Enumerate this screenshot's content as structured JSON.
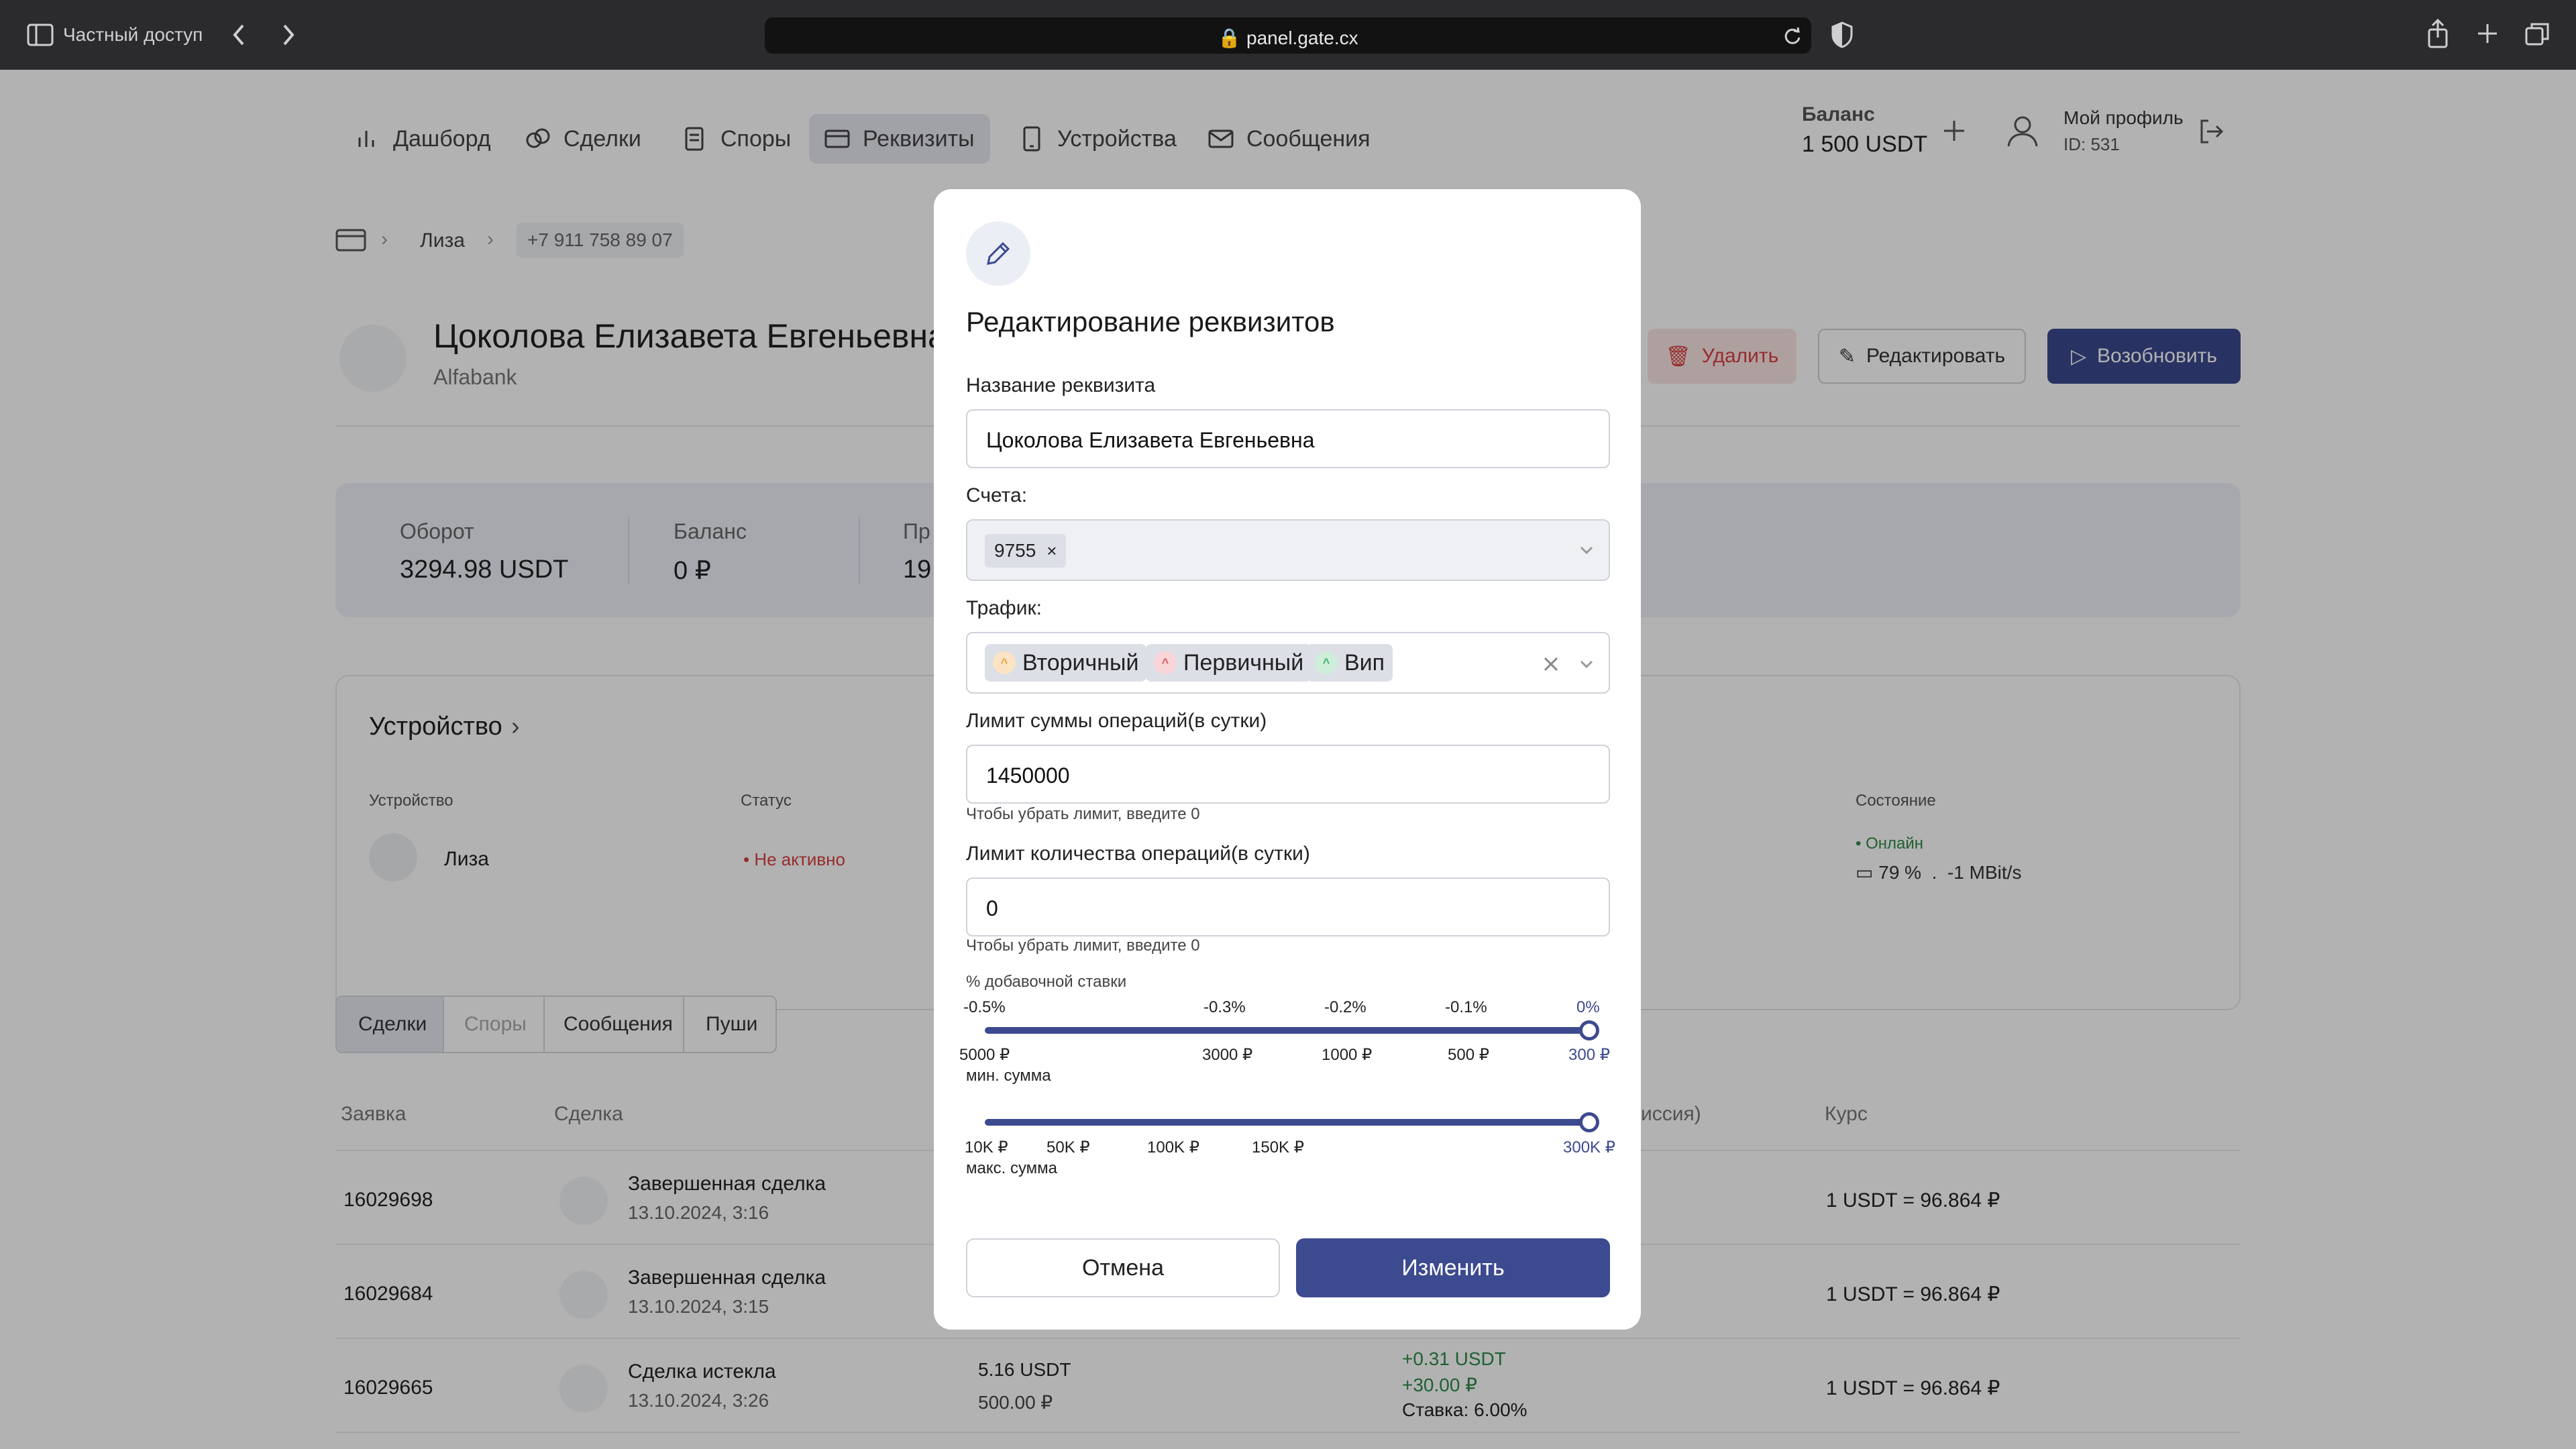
{
  "browser": {
    "private_label": "Частный доступ",
    "url": "panel.gate.cx"
  },
  "nav": {
    "items": [
      {
        "label": "Дашборд",
        "icon": "chart-icon"
      },
      {
        "label": "Сделки",
        "icon": "deals-icon"
      },
      {
        "label": "Споры",
        "icon": "disputes-icon"
      },
      {
        "label": "Реквизиты",
        "icon": "card-icon"
      },
      {
        "label": "Устройства",
        "icon": "device-icon"
      },
      {
        "label": "Сообщения",
        "icon": "mail-icon"
      }
    ],
    "balance_label": "Баланс",
    "balance_value": "1 500 USDT",
    "profile_label": "Мой профиль",
    "profile_id": "ID: 531"
  },
  "breadcrumb": {
    "item1": "Лиза",
    "item2": "+7 911 758 89 07"
  },
  "requisite": {
    "name": "Цоколова Елизавета Евгеньевна",
    "bank": "Alfabank",
    "delete_label": "Удалить",
    "edit_label": "Редактировать",
    "resume_label": "Возобновить"
  },
  "stats": {
    "turnover_label": "Оборот",
    "turnover_value": "3294.98 USDT",
    "balance_label": "Баланс",
    "balance_value": "0 ₽",
    "partial_label": "Пр",
    "partial_value": "19"
  },
  "device_card": {
    "title": "Устройство",
    "col_device": "Устройство",
    "col_status": "Статус",
    "col_state": "Состояние",
    "device_name": "Лиза",
    "status": "Не активно",
    "state": "Онлайн",
    "battery": "79 %",
    "separator": ".",
    "speed": "-1 MBit/s"
  },
  "tabs": [
    "Сделки",
    "Споры",
    "Сообщения",
    "Пуши"
  ],
  "table": {
    "col_request": "Заявка",
    "col_deal": "Сделка",
    "col_commission_tail": "иссия)",
    "col_rate": "Курс",
    "rows": [
      {
        "id": "16029698",
        "title": "Завершенная сделка",
        "date": "13.10.2024, 3:16",
        "rate": "1 USDT = 96.864 ₽"
      },
      {
        "id": "16029684",
        "title": "Завершенная сделка",
        "date": "13.10.2024, 3:15",
        "rate": "1 USDT = 96.864 ₽"
      },
      {
        "id": "16029665",
        "title": "Сделка истекла",
        "date": "13.10.2024, 3:26",
        "amount_usdt": "5.16 USDT",
        "amount_rub": "500.00 ₽",
        "comm_usdt": "+0.31 USDT",
        "comm_rub": "+30.00 ₽",
        "comm_rate": "Ставка: 6.00%",
        "rate": "1 USDT = 96.864 ₽"
      }
    ]
  },
  "modal": {
    "title": "Редактирование реквизитов",
    "name_label": "Название реквизита",
    "name_value": "Цоколова Елизавета Евгеньевна",
    "accounts_label": "Счета:",
    "account_chip": "9755",
    "traffic_label": "Трафик:",
    "traffic_chips": [
      {
        "label": "Вторичный",
        "color": "#f0a23a"
      },
      {
        "label": "Первичный",
        "color": "#e0525a"
      },
      {
        "label": "Вип",
        "color": "#3fae6a"
      }
    ],
    "sum_limit_label": "Лимит суммы операций(в сутки)",
    "sum_limit_value": "1450000",
    "sum_limit_hint": "Чтобы убрать лимит, введите 0",
    "count_limit_label": "Лимит количества операций(в сутки)",
    "count_limit_value": "0",
    "count_limit_hint": "Чтобы убрать лимит, введите 0",
    "rate_label": "% добавочной ставки",
    "rate_ticks": [
      "-0.5%",
      "-0.3%",
      "-0.2%",
      "-0.1%",
      "0%"
    ],
    "min_ticks": [
      "5000 ₽",
      "3000 ₽",
      "1000 ₽",
      "500 ₽",
      "300 ₽"
    ],
    "min_label": "мин. сумма",
    "max_ticks": [
      "10K ₽",
      "50K ₽",
      "100K ₽",
      "150K ₽",
      "300K ₽"
    ],
    "max_label": "макс. сумма",
    "min_slider_value": "300 ₽",
    "max_slider_value": "300K ₽",
    "cancel_label": "Отмена",
    "submit_label": "Изменить"
  },
  "colors": {
    "accent": "#3c4a8f",
    "danger": "#d94040",
    "success": "#2f8a4a"
  }
}
